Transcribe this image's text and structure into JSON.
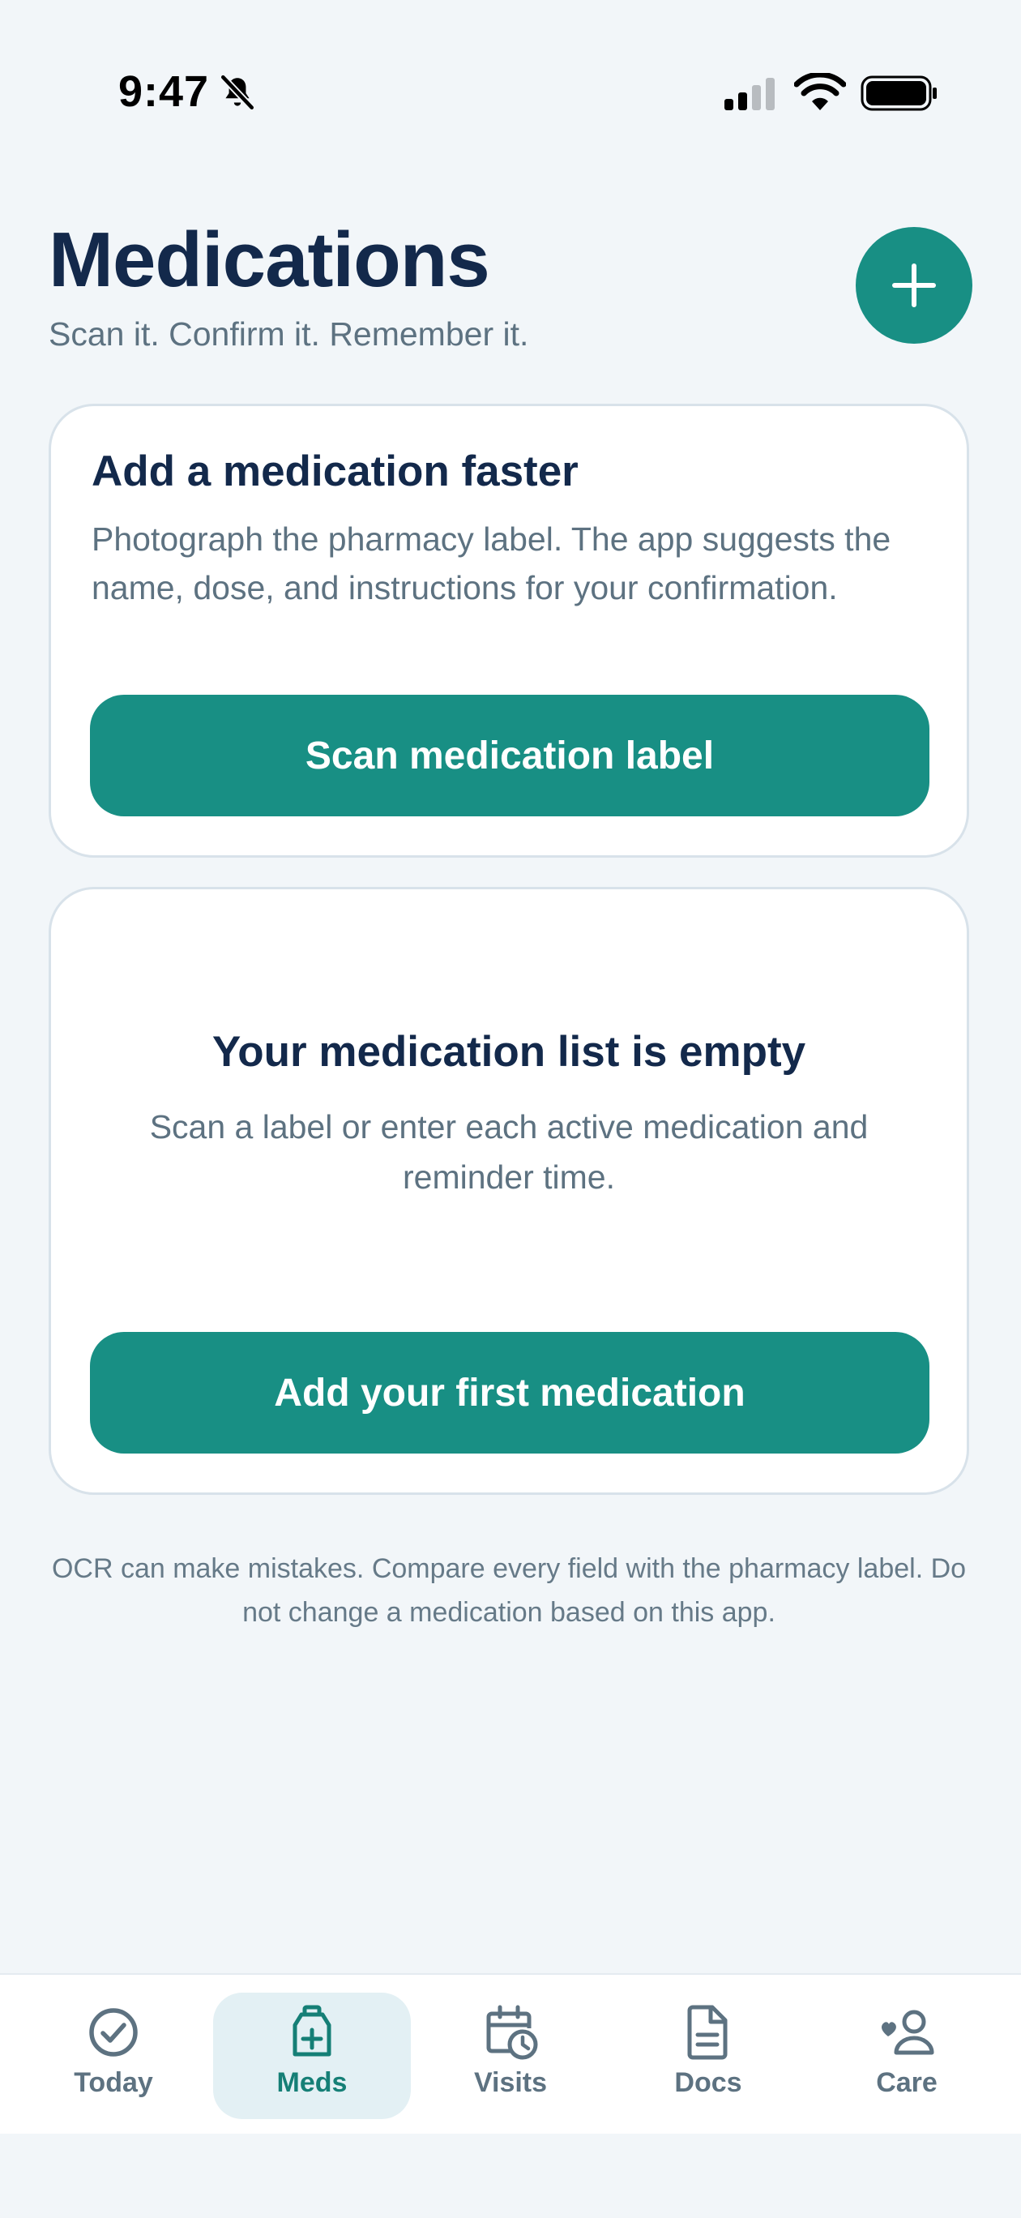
{
  "status_bar": {
    "time": "9:47",
    "icons": [
      "bell-slash-icon",
      "cellular-signal-icon",
      "wifi-icon",
      "battery-icon"
    ]
  },
  "header": {
    "title": "Medications",
    "subtitle": "Scan it. Confirm it. Remember it.",
    "add_button_icon": "plus-icon"
  },
  "scan_card": {
    "heading": "Add a medication faster",
    "body": "Photograph the pharmacy label. The app suggests the name, dose, and instructions for your confirmation.",
    "button_label": "Scan medication label"
  },
  "empty_state": {
    "heading": "Your medication list is empty",
    "body": "Scan a label or enter each active medication and reminder time.",
    "button_label": "Add your first medication"
  },
  "disclaimer": "OCR can make mistakes. Compare every field with the pharmacy label. Do not change a medication based on this app.",
  "tabs": [
    {
      "label": "Today",
      "icon": "check-circle-icon",
      "active": false
    },
    {
      "label": "Meds",
      "icon": "medicine-bottle-icon",
      "active": true
    },
    {
      "label": "Visits",
      "icon": "calendar-clock-icon",
      "active": false
    },
    {
      "label": "Docs",
      "icon": "document-icon",
      "active": false
    },
    {
      "label": "Care",
      "icon": "care-person-icon",
      "active": false
    }
  ],
  "colors": {
    "accent": "#188f84",
    "background": "#f2f6f9",
    "title": "#13294b",
    "muted_text": "#5d7281",
    "active_tab_bg": "#e3f0f4"
  }
}
